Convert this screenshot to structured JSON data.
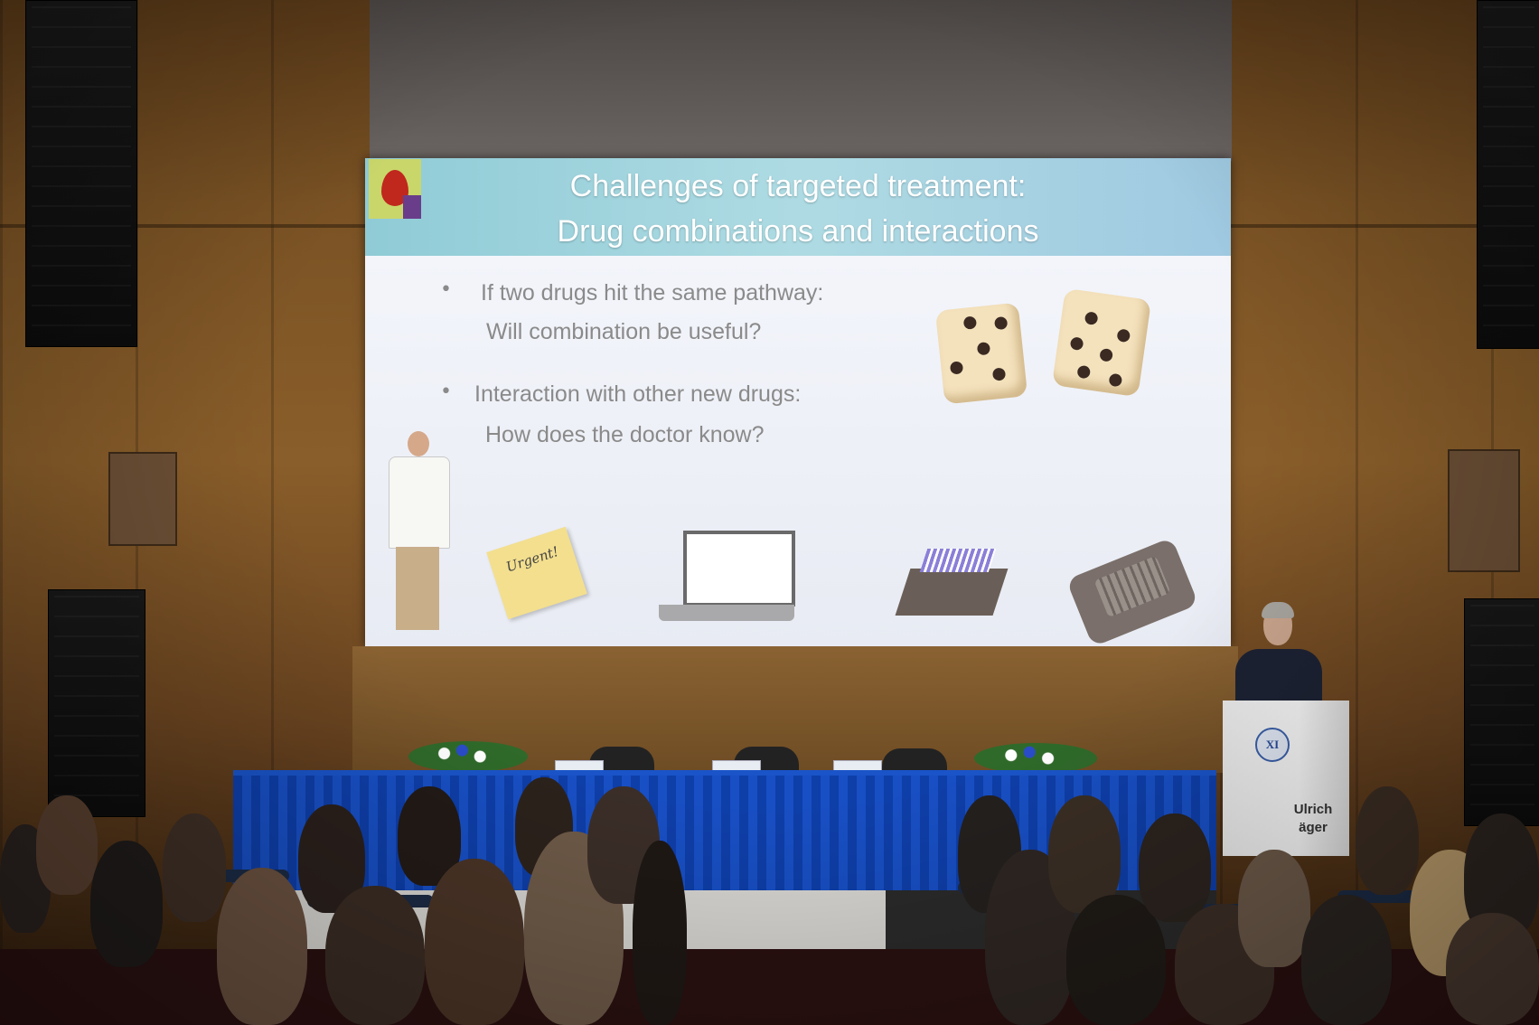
{
  "slide": {
    "title_line1": "Challenges of targeted treatment:",
    "title_line2": "Drug combinations and interactions",
    "bullets": [
      {
        "line1": "If two drugs hit the same pathway:",
        "line2": "Will combination be useful?"
      },
      {
        "line1": "Interaction with other new drugs:",
        "line2": "How does the doctor know?"
      }
    ],
    "note_text": "Urgent!",
    "bullet_symbol": "•"
  },
  "podium": {
    "logo_mark": "XI",
    "name_line1": "Ulrich",
    "name_line2": "äger"
  },
  "colors": {
    "slide_band": "#a9d8e1",
    "tablecloth": "#1547b8",
    "wall": "#7a5224"
  }
}
